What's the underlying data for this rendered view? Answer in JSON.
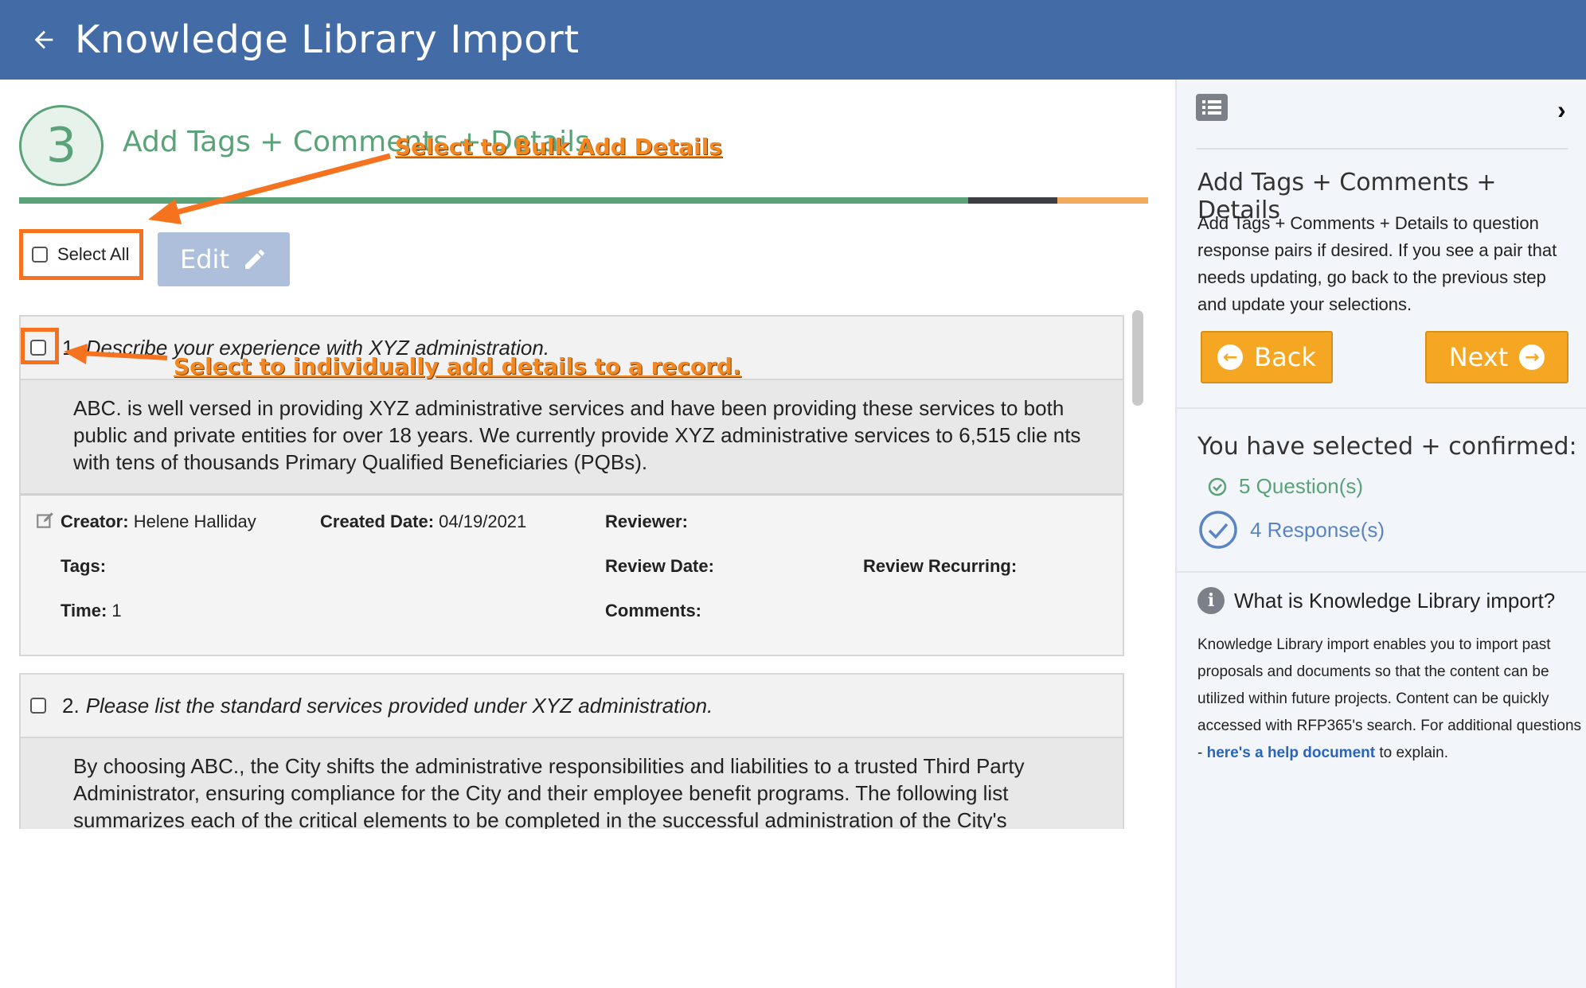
{
  "header": {
    "title": "Knowledge Library Import",
    "back_icon": "arrow-left-icon"
  },
  "step": {
    "number": "3",
    "title": "Add Tags + Comments + Details"
  },
  "progress_colors": [
    "#5aa378",
    "#3b3f44",
    "#f2ab5c"
  ],
  "annotations": {
    "bulk": "Select to Bulk Add Details",
    "individual": "Select to individually add details to a record."
  },
  "toolbar": {
    "select_all_label": "Select All",
    "edit_label": "Edit"
  },
  "records": [
    {
      "number": "1.",
      "question": "Describe your experience with XYZ administration.",
      "response": "ABC. is well versed in providing XYZ administrative services and have been providing these services to both public and private entities for over 18 years. We currently provide XYZ administrative services to 6,515 clie nts with tens of thousands Primary Qualified Beneficiaries (PQBs).",
      "details": {
        "creator_label": "Creator:",
        "creator": "Helene Halliday",
        "created_date_label": "Created Date:",
        "created_date": "04/19/2021",
        "reviewer_label": "Reviewer:",
        "tags_label": "Tags:",
        "review_date_label": "Review Date:",
        "review_recurring_label": "Review Recurring:",
        "time_label": "Time:",
        "time": "1",
        "comments_label": "Comments:"
      }
    },
    {
      "number": "2.",
      "question": "Please list the standard services provided under XYZ administration.",
      "response": "By choosing ABC., the City shifts the administrative responsibilities and liabilities to a trusted Third Party Administrator, ensuring compliance for the City and their employee benefit programs. The following list summarizes each of the critical elements to be completed in the successful administration of the City's"
    }
  ],
  "sidebar": {
    "title": "Add Tags + Comments + Details",
    "description": "Add Tags + Comments + Details to question response pairs if desired. If you see a pair that needs updating, go back to the previous step and update your selections.",
    "back_label": "Back",
    "next_label": "Next",
    "selected_title": "You have selected + confirmed:",
    "questions_stat": "5 Question(s)",
    "responses_stat": "4 Response(s)",
    "info_title": "What is Knowledge Library import?",
    "info_text_1": "Knowledge Library import enables you to import past proposals and documents so that the content can be utilized within future projects. Content can be quickly accessed with RFP365's search. For additional questions - ",
    "info_link": "here's a help document",
    "info_text_2": " to explain."
  },
  "colors": {
    "header": "#436ca6",
    "accent_green": "#5aa378",
    "accent_orange": "#f5a623",
    "annotation_orange": "#f5731f",
    "link_blue": "#2b65b8"
  }
}
